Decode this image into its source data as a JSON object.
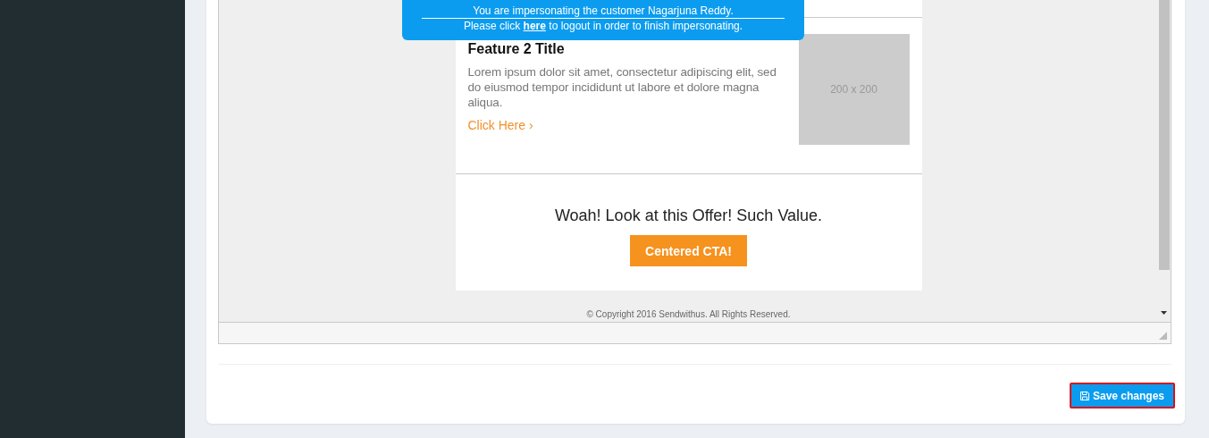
{
  "notice": {
    "line_1": "You are impersonating the customer Nagarjuna Reddy.",
    "line_2_before": "Please click",
    "link": "here",
    "line_2_after": "to logout in order to finish impersonating."
  },
  "email": {
    "feature": {
      "title": "Feature 2 Title",
      "body": "Lorem ipsum dolor sit amet, consectetur adipiscing elit, sed do eiusmod tempor incididunt ut labore et dolore magna aliqua.",
      "link": "Click Here ›",
      "image_label": "200 x 200"
    },
    "offer": {
      "heading": "Woah! Look at this Offer! Such Value.",
      "button": "Centered CTA!"
    },
    "footer": "© Copyright 2016 Sendwithus. All Rights Reserved."
  },
  "save_button": "Save changes"
}
